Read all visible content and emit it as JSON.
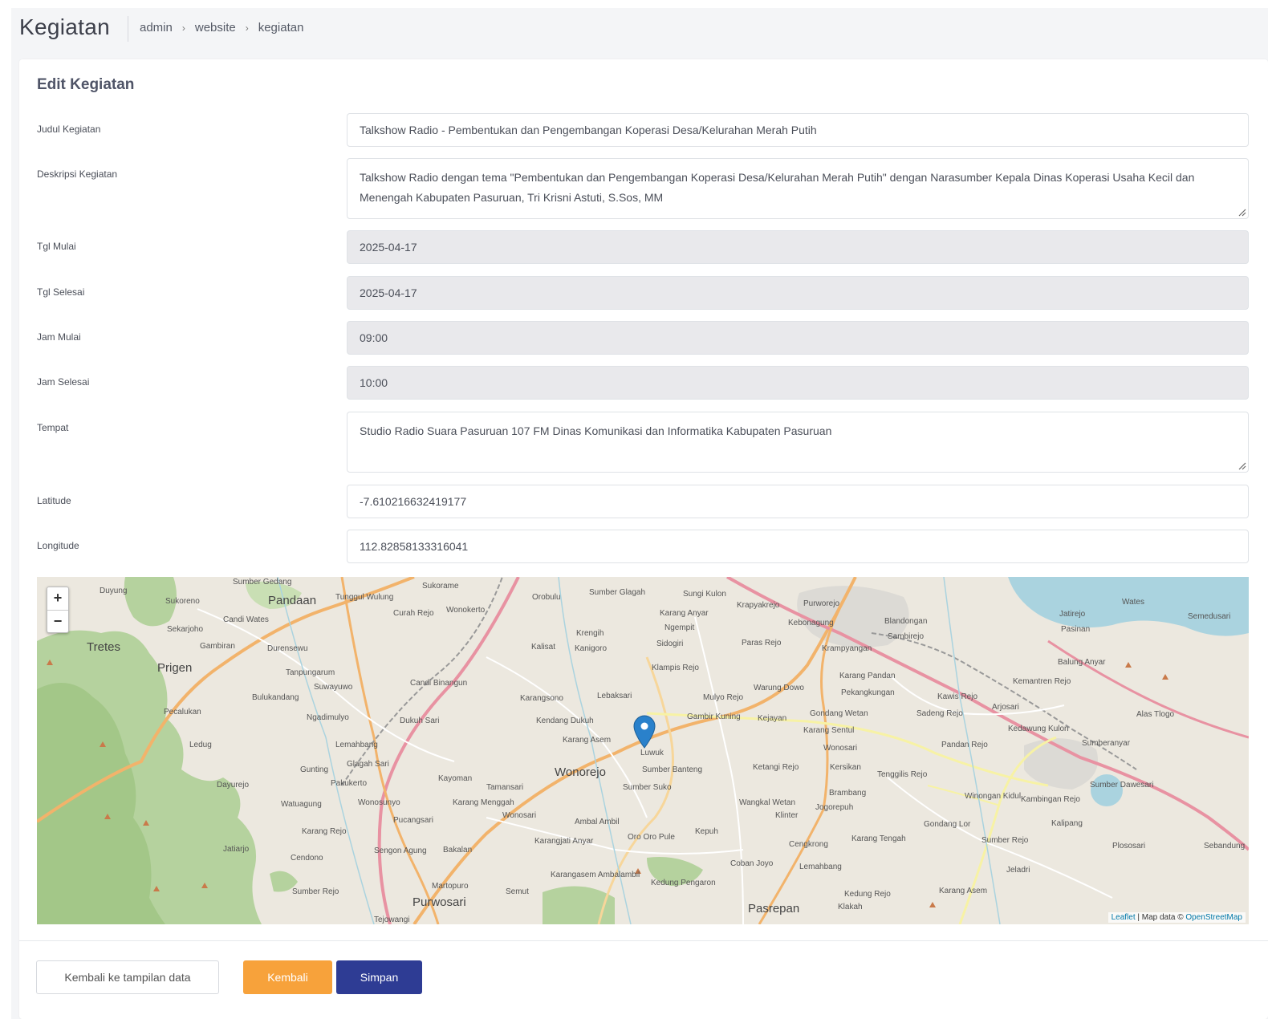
{
  "header": {
    "title": "Kegiatan",
    "breadcrumb": [
      "admin",
      "website",
      "kegiatan"
    ]
  },
  "form": {
    "title": "Edit Kegiatan",
    "fields": {
      "judul": {
        "label": "Judul Kegiatan",
        "value": "Talkshow Radio - Pembentukan dan Pengembangan Koperasi Desa/Kelurahan Merah Putih"
      },
      "deskripsi": {
        "label": "Deskripsi Kegiatan",
        "value": "Talkshow Radio dengan tema \"Pembentukan dan Pengembangan Koperasi Desa/Kelurahan Merah Putih\" dengan Narasumber Kepala Dinas Koperasi Usaha Kecil dan Menengah Kabupaten Pasuruan, Tri Krisni Astuti, S.Sos, MM"
      },
      "tgl_mulai": {
        "label": "Tgl Mulai",
        "value": "2025-04-17"
      },
      "tgl_selesai": {
        "label": "Tgl Selesai",
        "value": "2025-04-17"
      },
      "jam_mulai": {
        "label": "Jam Mulai",
        "value": "09:00"
      },
      "jam_selesai": {
        "label": "Jam Selesai",
        "value": "10:00"
      },
      "tempat": {
        "label": "Tempat",
        "value": "Studio Radio Suara Pasuruan 107 FM Dinas Komunikasi dan Informatika Kabupaten Pasuruan"
      },
      "latitude": {
        "label": "Latitude",
        "value": "-7.610216632419177"
      },
      "longitude": {
        "label": "Longitude",
        "value": "112.82858133316041"
      }
    }
  },
  "map": {
    "zoom_in": "+",
    "zoom_out": "−",
    "attribution": {
      "leaflet": "Leaflet",
      "sep": " | Map data © ",
      "osm": "OpenStreetMap"
    },
    "places": {
      "pandaan": "Pandaan",
      "prigen": "Prigen",
      "tretes": "Tretes",
      "wonorejo": "Wonorejo",
      "purwosari": "Purwosari",
      "pasrepan": "Pasrepan",
      "luwuk": "Luwuk",
      "sumber_banteng": "Sumber Banteng",
      "sumber_suko": "Sumber Suko",
      "karang_asem": "Karang Asem",
      "kendang_dukuh": "Kendang Dukuh",
      "gambir_kuning": "Gambir Kuning",
      "kejayan": "Kejayan",
      "lebaksari": "Lebaksari",
      "mulyo_rejo": "Mulyo Rejo",
      "klampis_rejo": "Klampis Rejo",
      "sidogiri": "Sidogiri",
      "warung_dowo": "Warung Dowo",
      "karang_sentul": "Karang Sentul",
      "gondang_wetan": "Gondang Wetan",
      "wonosari": "Wonosari",
      "kersikan": "Kersikan",
      "tenggilis_rejo": "Tenggilis Rejo",
      "pekangkungan": "Pekangkungan",
      "karang_pandan": "Karang Pandan",
      "kawis_rejo": "Kawis Rejo",
      "sadeng_rejo": "Sadeng Rejo",
      "pandan_rejo": "Pandan Rejo",
      "kedawung_kulon": "Kedawung Kulon",
      "sumber_dawesari": "Sumber Dawesari",
      "blandongan": "Blandongan",
      "krampyangan": "Krampyangan",
      "kebonagung": "Kebonagung",
      "paras_rejo": "Paras Rejo",
      "sungi_kulon": "Sungi Kulon",
      "krapyakrejo": "Krapyakrejo",
      "purworejo": "Purworejo",
      "karang_anyar": "Karang Anyar",
      "ngempit": "Ngempit",
      "sumber_glagah": "Sumber Glagah",
      "orobulu": "Orobulu",
      "sukorame": "Sukorame",
      "wonokerto": "Wonokerto",
      "curah_rejo": "Curah Rejo",
      "tunggul_wulung": "Tunggul Wulung",
      "sumber_gedang": "Sumber Gedang",
      "sukoreno": "Sukoreno",
      "candi_wates": "Candi Wates",
      "sekarjoho": "Sekarjoho",
      "gambiran": "Gambiran",
      "durensewu": "Durensewu",
      "tanpungarum": "Tanpungarum",
      "suwayuwo": "Suwayuwo",
      "bulukandang": "Bulukandang",
      "pecalukan": "Pecalukan",
      "ngadimulyo": "Ngadimulyo",
      "dukuh_sari": "Dukuh Sari",
      "candi_binangun": "Candi Binangun",
      "karangsono": "Karangsono",
      "lemahbang": "Lemahbang",
      "glagah_sari": "Glagah Sari",
      "gunting": "Gunting",
      "pakukerto": "Pakukerto",
      "dayurejo": "Dayurejo",
      "wonosunyo": "Wonosunyo",
      "kayoman": "Kayoman",
      "tamansari": "Tamansari",
      "karang_menggah": "Karang Menggah",
      "wonosari2": "Wonosari",
      "ambal_ambil": "Ambal Ambil",
      "karangjati_anyar": "Karangjati Anyar",
      "oro_oro_pule": "Oro Oro Pule",
      "kepuh": "Kepuh",
      "coban_joyo": "Coban Joyo",
      "cengkrong": "Cengkrong",
      "lemahbang2": "Lemahbang",
      "kedung_pengaron": "Kedung Pengaron",
      "karangasem_ambalambil": "Karangasem Ambalambil",
      "semut": "Semut",
      "martopuro": "Martopuro",
      "sengon_agung": "Sengon Agung",
      "bakalan": "Bakalan",
      "pucangsari": "Pucangsari",
      "cendono": "Cendono",
      "karang_rejo": "Karang Rejo",
      "jatiarjo": "Jatiarjo",
      "watuagung": "Watuagung",
      "sumber_rejo": "Sumber Rejo",
      "tejowangi": "Tejowangi",
      "wangkal_wetan": "Wangkal Wetan",
      "klinter": "Klinter",
      "jogorepuh": "Jogorepuh",
      "brambang": "Brambang",
      "karang_tengah": "Karang Tengah",
      "gondang_lor": "Gondang Lor",
      "winongan_kidul": "Winongan Kidul",
      "kambingan_rejo": "Kambingan Rejo",
      "kalipang": "Kalipang",
      "sumber_rejo2": "Sumber Rejo",
      "plososari": "Plososari",
      "jeladri": "Jeladri",
      "karang_asem2": "Karang Asem",
      "kedung_rejo": "Kedung Rejo",
      "klakah": "Klakah",
      "sebandung": "Sebandung",
      "sumberanyar": "Sumberanyar",
      "alas_tlogo": "Alas Tlogo",
      "kemantren_rejo": "Kemantren Rejo",
      "balung_anyar": "Balung Anyar",
      "pasinan": "Pasinan",
      "jatirejo": "Jatirejo",
      "wates": "Wates",
      "semedusari": "Semedusari",
      "sambirejo": "Sambirejo",
      "kalisat": "Kalisat",
      "krengih": "Krengih",
      "kanigoro": "Kanigoro",
      "duyung": "Duyung",
      "ledug": "Ledug",
      "arjosari": "Arjosari",
      "ketangi_rejo": "Ketangi Rejo"
    }
  },
  "buttons": {
    "back_to_list": "Kembali ke tampilan data",
    "back": "Kembali",
    "save": "Simpan"
  },
  "colors": {
    "orange": "#f7a23b",
    "navy": "#2e3c94",
    "readonly_bg": "#e9e9ec",
    "marker": "#2a81cb"
  }
}
